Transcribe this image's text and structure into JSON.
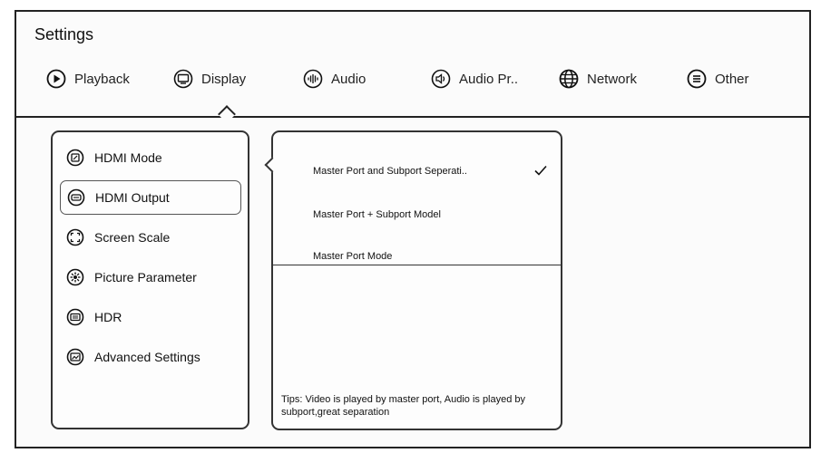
{
  "title": "Settings",
  "tabs": [
    {
      "label": "Playback",
      "icon": "play-circle-icon"
    },
    {
      "label": "Display",
      "icon": "display-icon"
    },
    {
      "label": "Audio",
      "icon": "audio-icon"
    },
    {
      "label": "Audio Pr..",
      "icon": "speaker-icon"
    },
    {
      "label": "Network",
      "icon": "globe-icon"
    },
    {
      "label": "Other",
      "icon": "menu-circle-icon"
    }
  ],
  "active_tab": "Display",
  "menu": [
    {
      "label": "HDMI Mode",
      "icon": "hdmi-mode-icon"
    },
    {
      "label": "HDMI Output",
      "icon": "hdmi-output-icon"
    },
    {
      "label": "Screen Scale",
      "icon": "screen-scale-icon"
    },
    {
      "label": "Picture Parameter",
      "icon": "picture-parameter-icon"
    },
    {
      "label": "HDR",
      "icon": "hdr-icon"
    },
    {
      "label": "Advanced Settings",
      "icon": "advanced-settings-icon"
    }
  ],
  "active_menu_item": "HDMI Output",
  "options": [
    {
      "label": "Master Port and Subport Seperati..",
      "selected": true
    },
    {
      "label": "Master Port + Subport Model",
      "selected": false
    },
    {
      "label": "Master Port Mode",
      "selected": false
    }
  ],
  "tips": "Tips:  Video is played by master port, Audio is played by subport,great separation"
}
